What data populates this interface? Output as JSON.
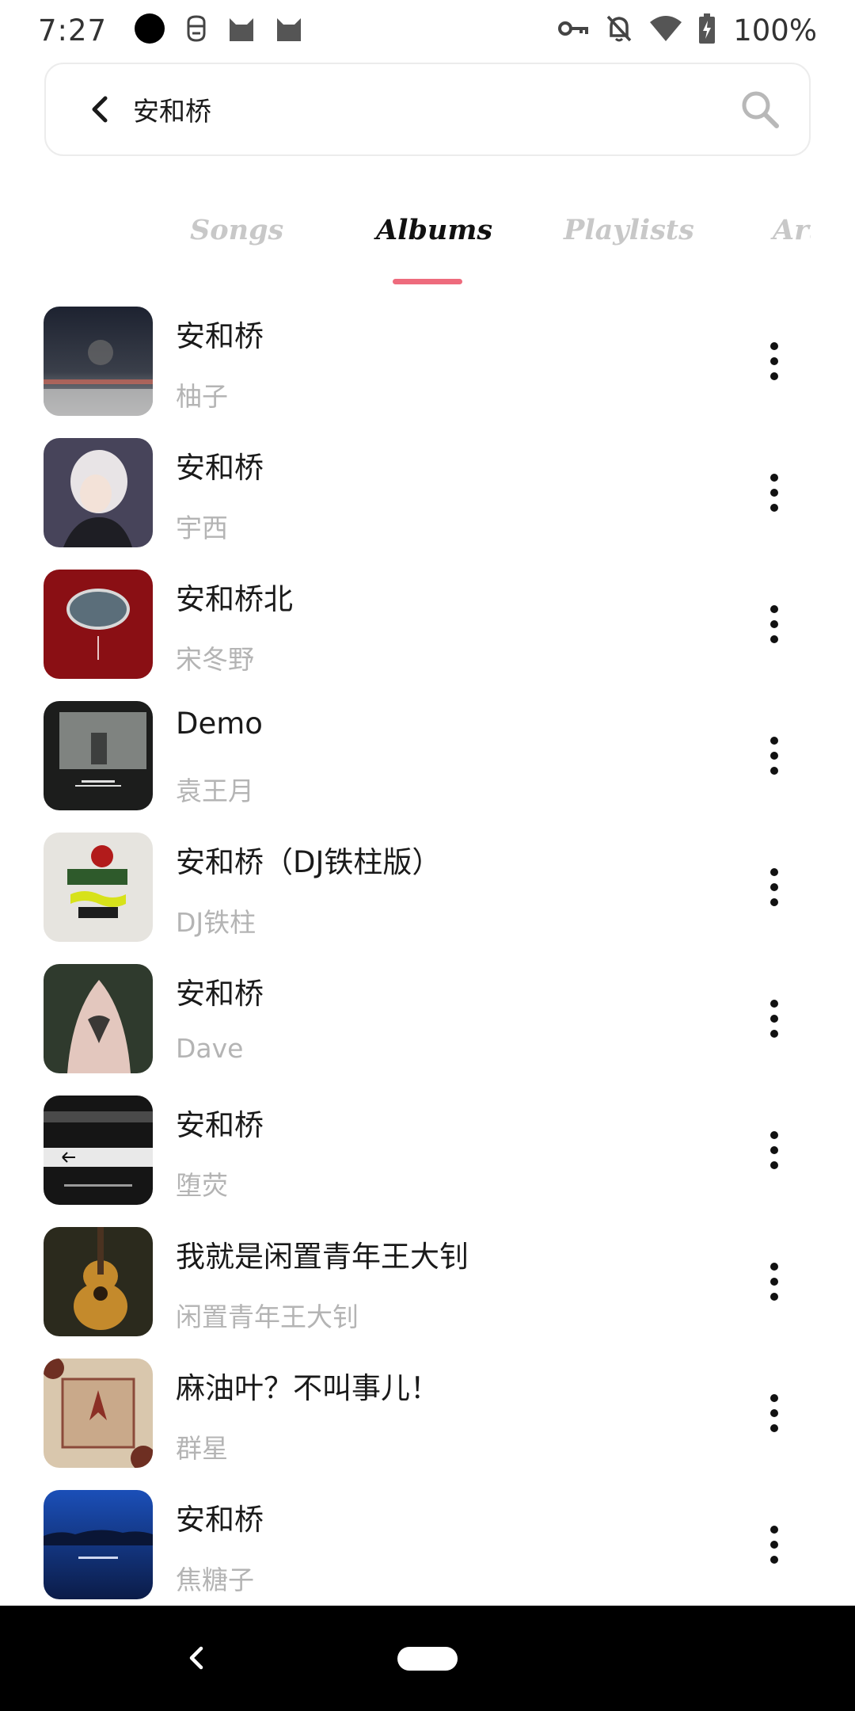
{
  "status_bar": {
    "time": "7:27",
    "battery_text": "100%",
    "icons": [
      "record-dot-icon",
      "robot-face-icon",
      "cat-icon",
      "cat-icon",
      "vpn-key-icon",
      "bell-off-icon",
      "wifi-icon",
      "battery-charging-icon"
    ]
  },
  "search": {
    "query": "安和桥",
    "back_icon": "chevron-left-icon",
    "search_icon": "search-icon"
  },
  "tabs": [
    {
      "label": "Songs",
      "active": false
    },
    {
      "label": "Albums",
      "active": true
    },
    {
      "label": "Playlists",
      "active": false
    },
    {
      "label": "Artists",
      "active": false
    }
  ],
  "accent_color": "#ee6b7d",
  "albums": [
    {
      "title": "安和桥",
      "artist": "柚子"
    },
    {
      "title": "安和桥",
      "artist": "宇西"
    },
    {
      "title": "安和桥北",
      "artist": "宋冬野"
    },
    {
      "title": "Demo",
      "artist": "袁王月"
    },
    {
      "title": "安和桥（DJ铁柱版）",
      "artist": "DJ铁柱"
    },
    {
      "title": "安和桥",
      "artist": "Dave"
    },
    {
      "title": "安和桥",
      "artist": "堕荧"
    },
    {
      "title": "我就是闲置青年王大钊",
      "artist": "闲置青年王大钊"
    },
    {
      "title": "麻油叶？不叫事儿！",
      "artist": "群星"
    },
    {
      "title": "安和桥",
      "artist": "焦糖子"
    }
  ],
  "nav_bar": {
    "back_icon": "nav-back-icon",
    "home_icon": "home-pill-icon"
  }
}
